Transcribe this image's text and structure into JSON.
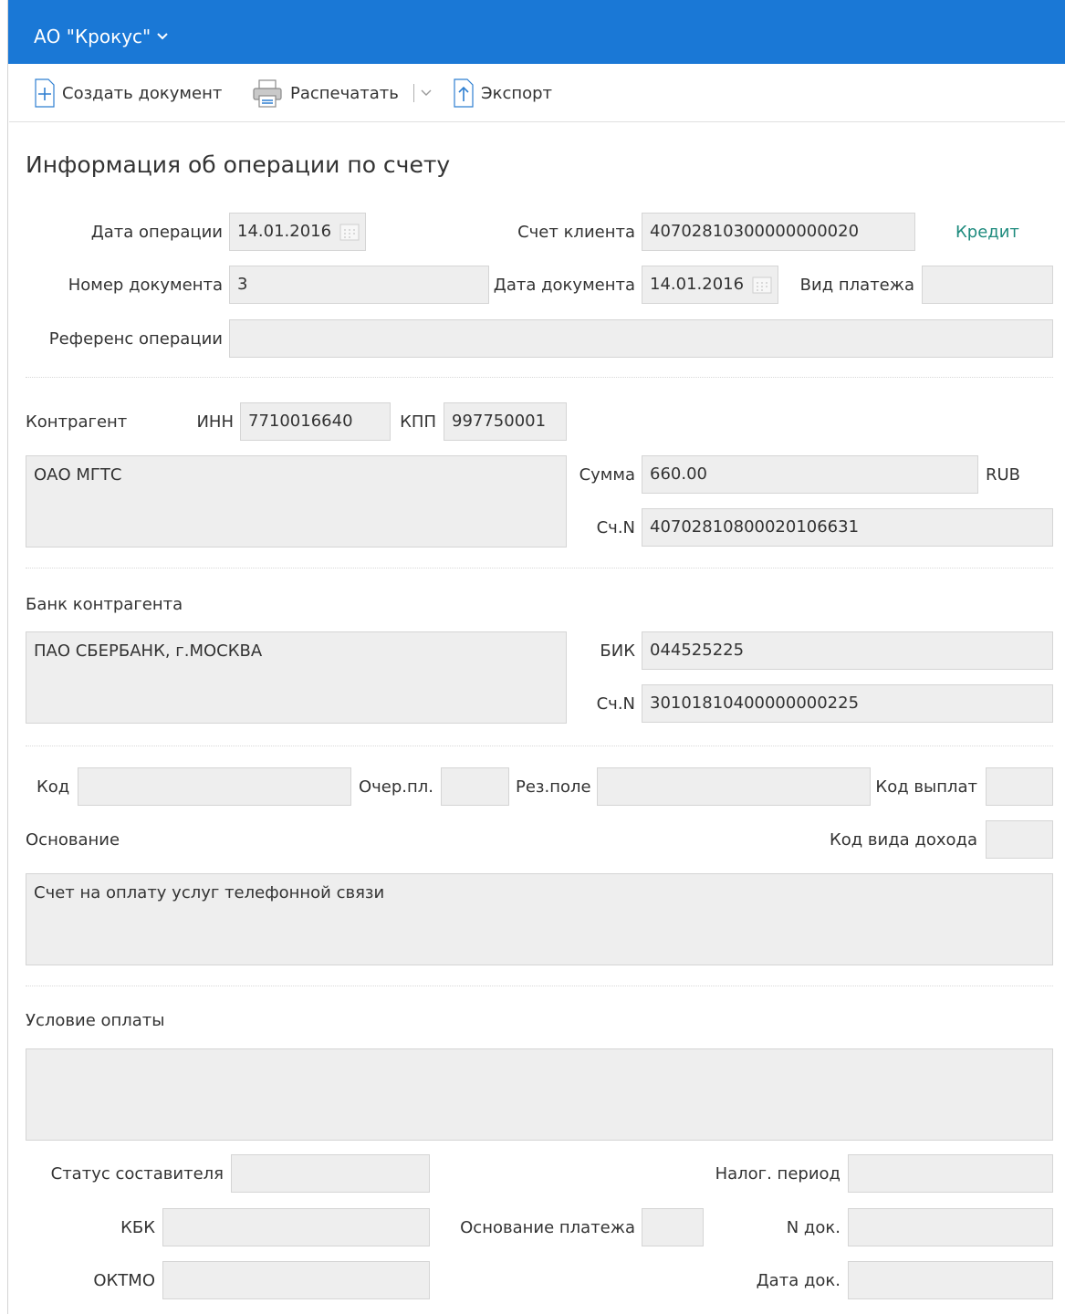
{
  "header": {
    "company": "АО \"Крокус\""
  },
  "toolbar": {
    "create": "Создать документ",
    "print": "Распечатать",
    "export": "Экспорт"
  },
  "page": {
    "title": "Информация об операции по счету"
  },
  "operation": {
    "date_label": "Дата операции",
    "date": "14.01.2016",
    "account_label": "Счет клиента",
    "account": "40702810300000000020",
    "direction": "Кредит",
    "doc_number_label": "Номер документа",
    "doc_number": "3",
    "doc_date_label": "Дата документа",
    "doc_date": "14.01.2016",
    "payment_type_label": "Вид платежа",
    "payment_type": "",
    "reference_label": "Референс операции",
    "reference": ""
  },
  "counterparty": {
    "label": "Контрагент",
    "inn_label": "ИНН",
    "inn": "7710016640",
    "kpp_label": "КПП",
    "kpp": "997750001",
    "name": "ОАО МГТС",
    "amount_label": "Сумма",
    "amount": "660.00",
    "currency": "RUB",
    "account_label": "Сч.N",
    "account": "40702810800020106631"
  },
  "bank": {
    "label": "Банк контрагента",
    "name": "ПАО СБЕРБАНК, г.МОСКВА",
    "bik_label": "БИК",
    "bik": "044525225",
    "account_label": "Сч.N",
    "account": "30101810400000000225"
  },
  "details": {
    "code_label": "Код",
    "code": "",
    "queue_label": "Очер.пл.",
    "queue": "",
    "reserve_label": "Рез.поле",
    "reserve": "",
    "payout_code_label": "Код выплат",
    "payout_code": "",
    "basis_label": "Основание",
    "income_code_label": "Код вида дохода",
    "income_code": "",
    "basis": "Счет на оплату услуг телефонной связи"
  },
  "terms": {
    "label": "Условие оплаты",
    "value": ""
  },
  "tax": {
    "status_label": "Статус составителя",
    "status": "",
    "period_label": "Налог. период",
    "period": "",
    "kbk_label": "КБК",
    "kbk": "",
    "basis_label": "Основание платежа",
    "basis": "",
    "doc_no_label": "N док.",
    "doc_no": "",
    "oktmo_label": "ОКТМО",
    "oktmo": "",
    "doc_date_label": "Дата док.",
    "doc_date": ""
  }
}
